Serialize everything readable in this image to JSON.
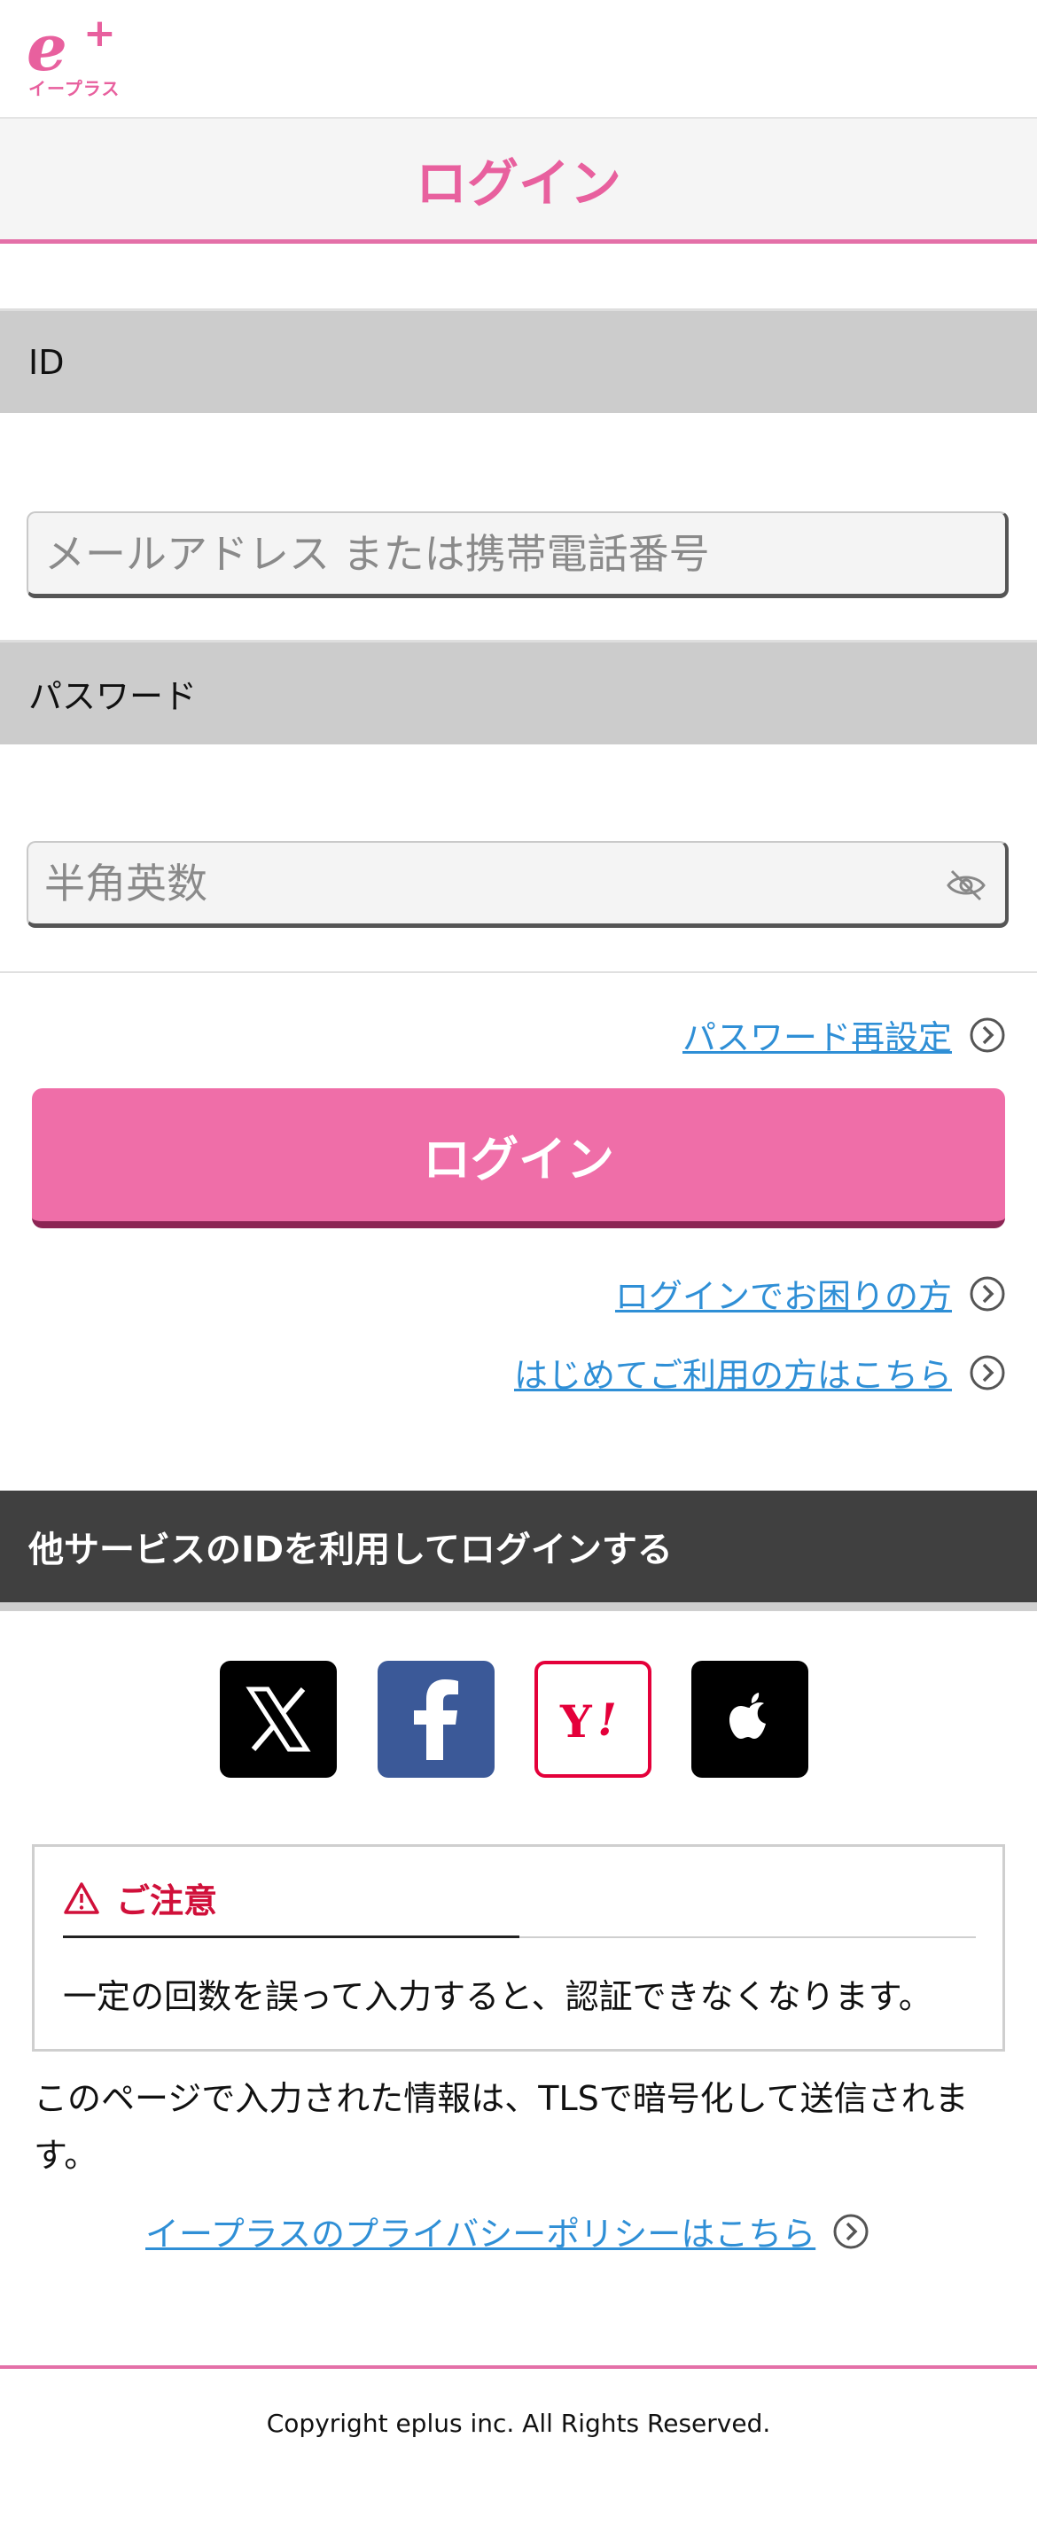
{
  "brand": {
    "logo_mark": "e+",
    "logo_text": "イープラス",
    "accent": "#e8609e"
  },
  "header": {
    "title": "ログイン"
  },
  "form": {
    "id_label": "ID",
    "id_placeholder": "メールアドレス または携帯電話番号",
    "password_label": "パスワード",
    "password_placeholder": "半角英数"
  },
  "links": {
    "password_reset": "パスワード再設定",
    "login_help": "ログインでお困りの方",
    "first_time": "はじめてご利用の方はこちら",
    "privacy": "イープラスのプライバシーポリシーはこちら"
  },
  "login_button": {
    "label": "ログイン",
    "color": "#ef6ea8"
  },
  "other_services": {
    "heading": "他サービスのIDを利用してログインする",
    "providers": [
      {
        "name": "X",
        "icon": "x-logo-icon"
      },
      {
        "name": "Facebook",
        "icon": "facebook-logo-icon"
      },
      {
        "name": "Yahoo",
        "icon": "yahoo-logo-icon"
      },
      {
        "name": "Apple",
        "icon": "apple-logo-icon"
      }
    ]
  },
  "notice": {
    "title": "ご注意",
    "body": "一定の回数を誤って入力すると、認証できなくなります。",
    "color": "#d0103a"
  },
  "tls_notice": "このページで入力された情報は、TLSで暗号化して送信されます。",
  "footer": {
    "copyright": "Copyright eplus inc. All Rights Reserved."
  }
}
